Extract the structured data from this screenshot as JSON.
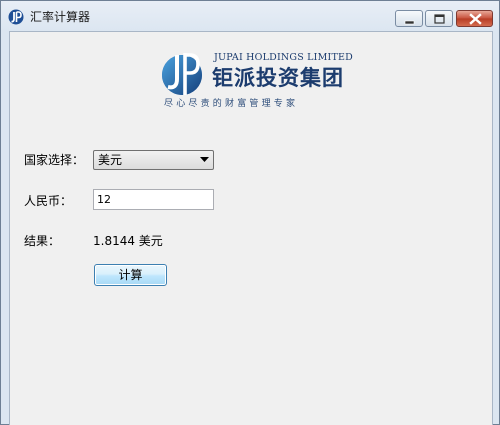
{
  "window": {
    "title": "汇率计算器",
    "controls": [
      "minimize",
      "maximize",
      "close"
    ]
  },
  "logo": {
    "icon": "jupai-jp-logo-icon",
    "company_en": "JUPAI HOLDINGS LIMITED",
    "company_cn": "钜派投资集团",
    "slogan": "尽心尽责的财富管理专家"
  },
  "form": {
    "country_label": "国家选择：",
    "country_selected": "美元",
    "rmb_label": "人民币：",
    "rmb_value": "12",
    "result_label": "结果：",
    "result_value": "1.8144 美元",
    "calculate_label": "计算"
  },
  "colors": {
    "brand_blue": "#1c3c6e",
    "client_bg": "#f0f0f0",
    "close_button_red": "#c7503b"
  }
}
